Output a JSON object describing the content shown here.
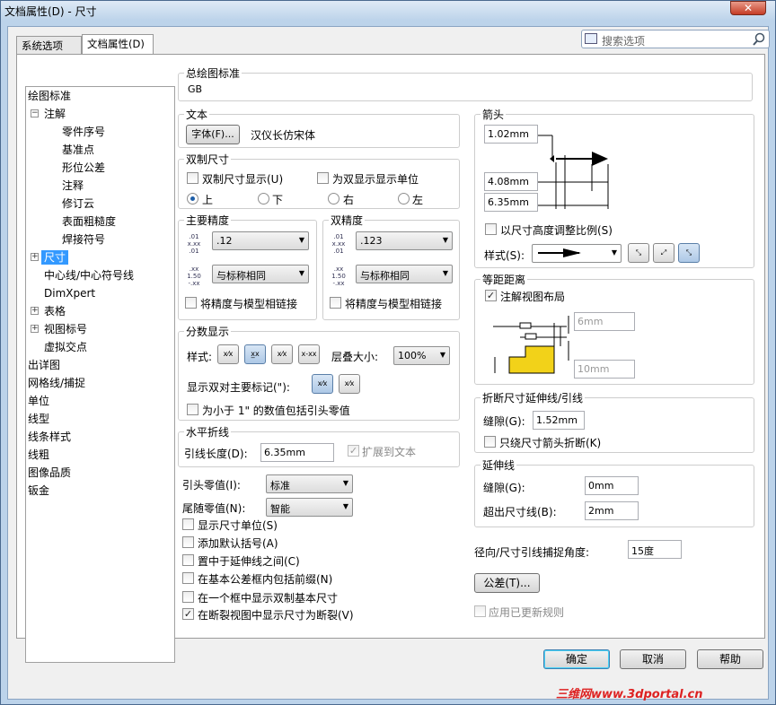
{
  "window": {
    "title": "文档属性(D) - 尺寸",
    "close": "✕"
  },
  "tabs": [
    {
      "label": "系统选项(S)"
    },
    {
      "label": "文档属性(D)"
    }
  ],
  "search": {
    "placeholder": "搜索选项"
  },
  "tree": {
    "items": [
      {
        "label": "绘图标准",
        "expander": ""
      },
      {
        "label": "注解",
        "expander": "−"
      },
      {
        "label": "零件序号"
      },
      {
        "label": "基准点"
      },
      {
        "label": "形位公差"
      },
      {
        "label": "注释"
      },
      {
        "label": "修订云"
      },
      {
        "label": "表面粗糙度"
      },
      {
        "label": "焊接符号"
      },
      {
        "label": "尺寸",
        "expander": "+",
        "selected": true
      },
      {
        "label": "中心线/中心符号线"
      },
      {
        "label": "DimXpert"
      },
      {
        "label": "表格",
        "expander": "+"
      },
      {
        "label": "视图标号",
        "expander": "+"
      },
      {
        "label": "虚拟交点"
      },
      {
        "label": "出详图"
      },
      {
        "label": "网格线/捕捉"
      },
      {
        "label": "单位"
      },
      {
        "label": "线型"
      },
      {
        "label": "线条样式"
      },
      {
        "label": "线粗"
      },
      {
        "label": "图像品质"
      },
      {
        "label": "钣金"
      }
    ]
  },
  "overall_standard": {
    "title": "总绘图标准",
    "value": "GB"
  },
  "text": {
    "title": "文本",
    "font_button": "字体(F)...",
    "font_name": "汉仪长仿宋体"
  },
  "dual": {
    "title": "双制尺寸",
    "show_dual": "双制尺寸显示(U)",
    "show_units": "为双显示显示单位",
    "positions": [
      "上",
      "下",
      "右",
      "左"
    ]
  },
  "primary_precision": {
    "title": "主要精度",
    "value1": ".12",
    "value2": "与标称相同",
    "link": "将精度与模型相链接"
  },
  "dual_precision": {
    "title": "双精度",
    "value1": ".123",
    "value2": "与标称相同",
    "link": "将精度与模型相链接"
  },
  "fraction": {
    "title": "分数显示",
    "style_label": "样式:",
    "stack_label": "层叠大小:",
    "stack_value": "100%",
    "dual_mark_label": "显示双对主要标记(\"):",
    "leading_zero": "为小于 1\" 的数值包括引头零值"
  },
  "horizontal_leader": {
    "title": "水平折线",
    "length_label": "引线长度(D):",
    "length_value": "6.35mm",
    "extend": "扩展到文本"
  },
  "zeros": {
    "leading_label": "引头零值(I):",
    "leading_value": "标准",
    "trailing_label": "尾随零值(N):",
    "trailing_value": "智能"
  },
  "options": [
    {
      "label": "显示尺寸单位(S)",
      "checked": false
    },
    {
      "label": "添加默认括号(A)",
      "checked": false
    },
    {
      "label": "置中于延伸线之间(C)",
      "checked": false
    },
    {
      "label": "在基本公差框内包括前缀(N)",
      "checked": false
    },
    {
      "label": "在一个框中显示双制基本尺寸",
      "checked": false
    },
    {
      "label": "在断裂视图中显示尺寸为断裂(V)",
      "checked": true
    }
  ],
  "arrows": {
    "title": "箭头",
    "v1": "1.02mm",
    "v2": "4.08mm",
    "v3": "6.35mm",
    "scale": "以尺寸高度调整比例(S)",
    "style_label": "样式(S):"
  },
  "offset": {
    "title": "等距距离",
    "layout": "注解视图布局",
    "v1": "6mm",
    "v2": "10mm"
  },
  "break": {
    "title": "折断尺寸延伸线/引线",
    "gap_label": "缝隙(G):",
    "gap_value": "1.52mm",
    "arrow_only": "只绕尺寸箭头折断(K)"
  },
  "extension": {
    "title": "延伸线",
    "gap_label": "缝隙(G):",
    "gap_value": "0mm",
    "beyond_label": "超出尺寸线(B):",
    "beyond_value": "2mm"
  },
  "snap": {
    "label": "径向/尺寸引线捕捉角度:",
    "value": "15度"
  },
  "tolerance_button": "公差(T)...",
  "apply_updated": "应用已更新规则",
  "footer": {
    "ok": "确定",
    "cancel": "取消",
    "help": "帮助"
  },
  "watermark": "三维网www.3dportal.cn"
}
